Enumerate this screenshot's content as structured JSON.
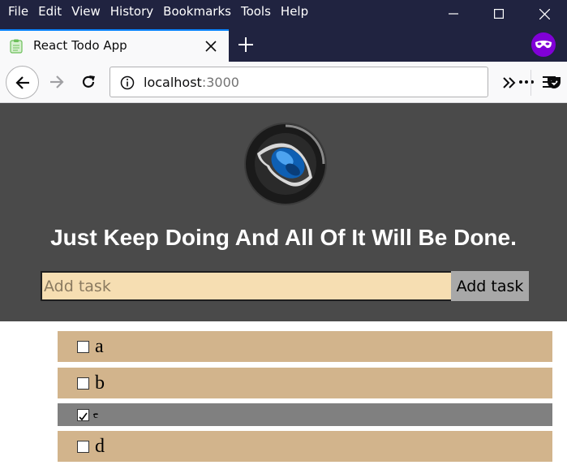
{
  "menu": [
    "File",
    "Edit",
    "View",
    "History",
    "Bookmarks",
    "Tools",
    "Help"
  ],
  "tab": {
    "title": "React Todo App"
  },
  "urlbar": {
    "host": "localhost",
    "port": ":3000"
  },
  "app": {
    "title": "Just Keep Doing And All Of It Will Be Done.",
    "input_placeholder": "Add task",
    "input_value": "",
    "add_button": "Add task"
  },
  "todos": [
    {
      "label": "a",
      "done": false
    },
    {
      "label": "b",
      "done": false
    },
    {
      "label": "c",
      "done": true
    },
    {
      "label": "d",
      "done": false
    }
  ],
  "colors": {
    "titlebar": "#202340",
    "header_bg": "#4a4a4a",
    "todo_bg": "#d2b48c",
    "todo_done_bg": "#808080",
    "input_bg": "#f6deb2",
    "private_badge": "#8000d7"
  },
  "icons": [
    "minimize-icon",
    "maximize-icon",
    "close-icon",
    "clipboard-favicon-icon",
    "tab-close-icon",
    "plus-icon",
    "private-browsing-icon",
    "back-arrow-icon",
    "forward-arrow-icon",
    "reload-icon",
    "info-icon",
    "ellipsis-icon",
    "pocket-icon",
    "star-icon",
    "chevron-double-right-icon",
    "hamburger-menu-icon",
    "steering-wheel-logo"
  ]
}
